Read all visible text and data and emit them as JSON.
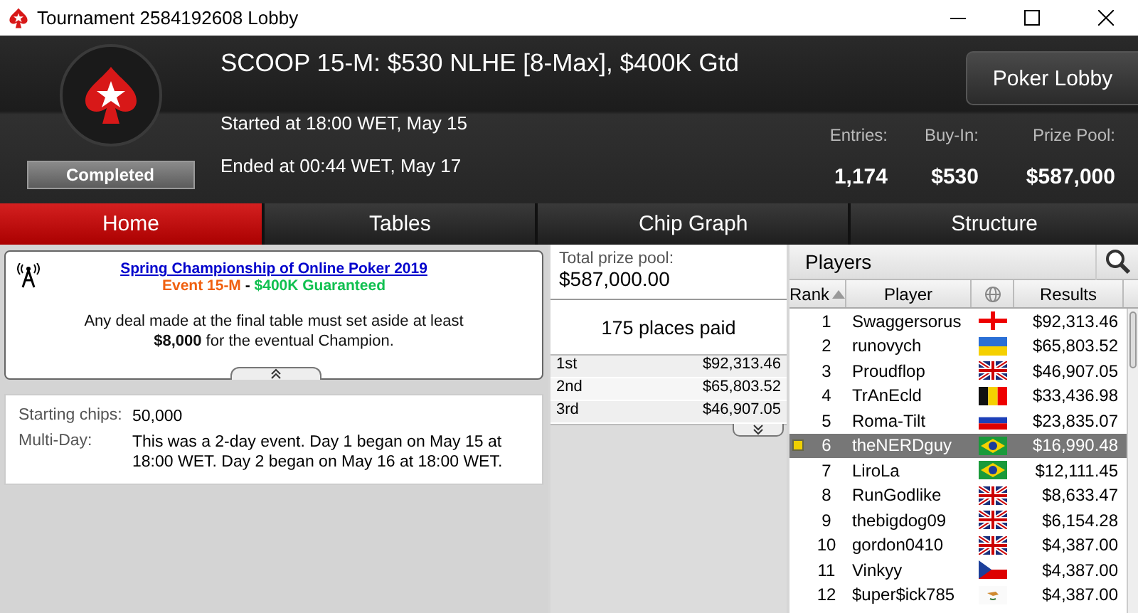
{
  "window": {
    "title": "Tournament 2584192608 Lobby"
  },
  "header": {
    "title": "SCOOP 15-M: $530 NLHE [8-Max], $400K Gtd",
    "status": "Completed",
    "started": "Started at 18:00 WET, May 15",
    "ended": "Ended at 00:44 WET, May 17",
    "lobby_button": "Poker Lobby",
    "stats": [
      {
        "label": "Entries:",
        "value": "1,174"
      },
      {
        "label": "Buy-In:",
        "value": "$530"
      },
      {
        "label": "Prize Pool:",
        "value": "$587,000"
      }
    ]
  },
  "tabs": [
    {
      "label": "Home",
      "selected": true
    },
    {
      "label": "Tables",
      "selected": false
    },
    {
      "label": "Chip Graph",
      "selected": false
    },
    {
      "label": "Structure",
      "selected": false
    }
  ],
  "notice": {
    "link": "Spring Championship of Online Poker 2019",
    "event": "Event 15-M",
    "separator": " - ",
    "guarantee": "$400K Guaranteed",
    "message": "Any deal made at the final table must set aside at least **$8,000** for the eventual Champion."
  },
  "details": [
    {
      "label": "Starting chips:",
      "value": "50,000"
    },
    {
      "label": "Multi-Day:",
      "value": "This was a 2-day event. Day 1 began on May 15 at 18:00 WET. Day 2 began on May 16 at 18:00 WET."
    }
  ],
  "prizes": {
    "total_label": "Total prize pool:",
    "total": "$587,000.00",
    "places": "175 places paid",
    "rows": [
      {
        "place": "1st",
        "amount": "$92,313.46"
      },
      {
        "place": "2nd",
        "amount": "$65,803.52"
      },
      {
        "place": "3rd",
        "amount": "$46,907.05"
      }
    ]
  },
  "players": {
    "title": "Players",
    "columns": [
      "Rank",
      "Player",
      "Results"
    ],
    "rows": [
      {
        "rank": "1",
        "name": "Swaggersorus",
        "kind": "ge",
        "result": "$92,313.46",
        "selected": false
      },
      {
        "rank": "2",
        "name": "runovych",
        "kind": "ua",
        "result": "$65,803.52",
        "selected": false
      },
      {
        "rank": "3",
        "name": "Proudflop",
        "kind": "gb",
        "result": "$46,907.05",
        "selected": false
      },
      {
        "rank": "4",
        "name": "TrAnEcld",
        "kind": "be",
        "result": "$33,436.98",
        "selected": false
      },
      {
        "rank": "5",
        "name": "Roma-Tilt",
        "kind": "ru",
        "result": "$23,835.07",
        "selected": false
      },
      {
        "rank": "6",
        "name": "theNERDguy",
        "kind": "br",
        "result": "$16,990.48",
        "selected": true
      },
      {
        "rank": "7",
        "name": "LiroLa",
        "kind": "br",
        "result": "$12,111.45",
        "selected": false
      },
      {
        "rank": "8",
        "name": "RunGodlike",
        "kind": "gb",
        "result": "$8,633.47",
        "selected": false
      },
      {
        "rank": "9",
        "name": "thebigdog09",
        "kind": "gb",
        "result": "$6,154.28",
        "selected": false
      },
      {
        "rank": "10",
        "name": "gordon0410",
        "kind": "gb",
        "result": "$4,387.00",
        "selected": false
      },
      {
        "rank": "11",
        "name": "Vinkyy",
        "kind": "cz",
        "result": "$4,387.00",
        "selected": false
      },
      {
        "rank": "12",
        "name": "$uper$ick785",
        "kind": "cy",
        "result": "$4,387.00",
        "selected": false
      }
    ]
  }
}
